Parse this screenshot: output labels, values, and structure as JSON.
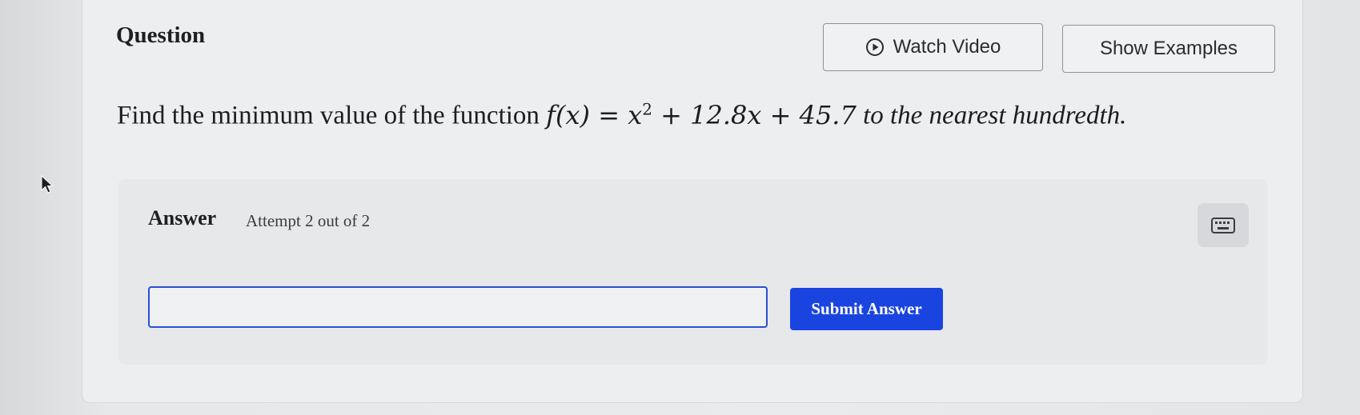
{
  "header": {
    "title": "Question",
    "watch_video_label": "Watch Video",
    "show_examples_label": "Show Examples"
  },
  "question": {
    "prefix": "Find the minimum value of the function ",
    "math_lhs": "f(x) = x",
    "math_exponent": "2",
    "math_rhs": " + 12.8x + 45.7",
    "suffix": " to the nearest hundredth."
  },
  "answer": {
    "label": "Answer",
    "attempt_text": "Attempt 2 out of 2",
    "input_value": "",
    "input_placeholder": "",
    "submit_label": "Submit Answer"
  },
  "icons": {
    "play": "play-circle-icon",
    "keyboard": "keyboard-icon",
    "cursor": "mouse-pointer-icon"
  },
  "colors": {
    "accent": "#1a44e0",
    "input_border": "#2a4fd6"
  }
}
